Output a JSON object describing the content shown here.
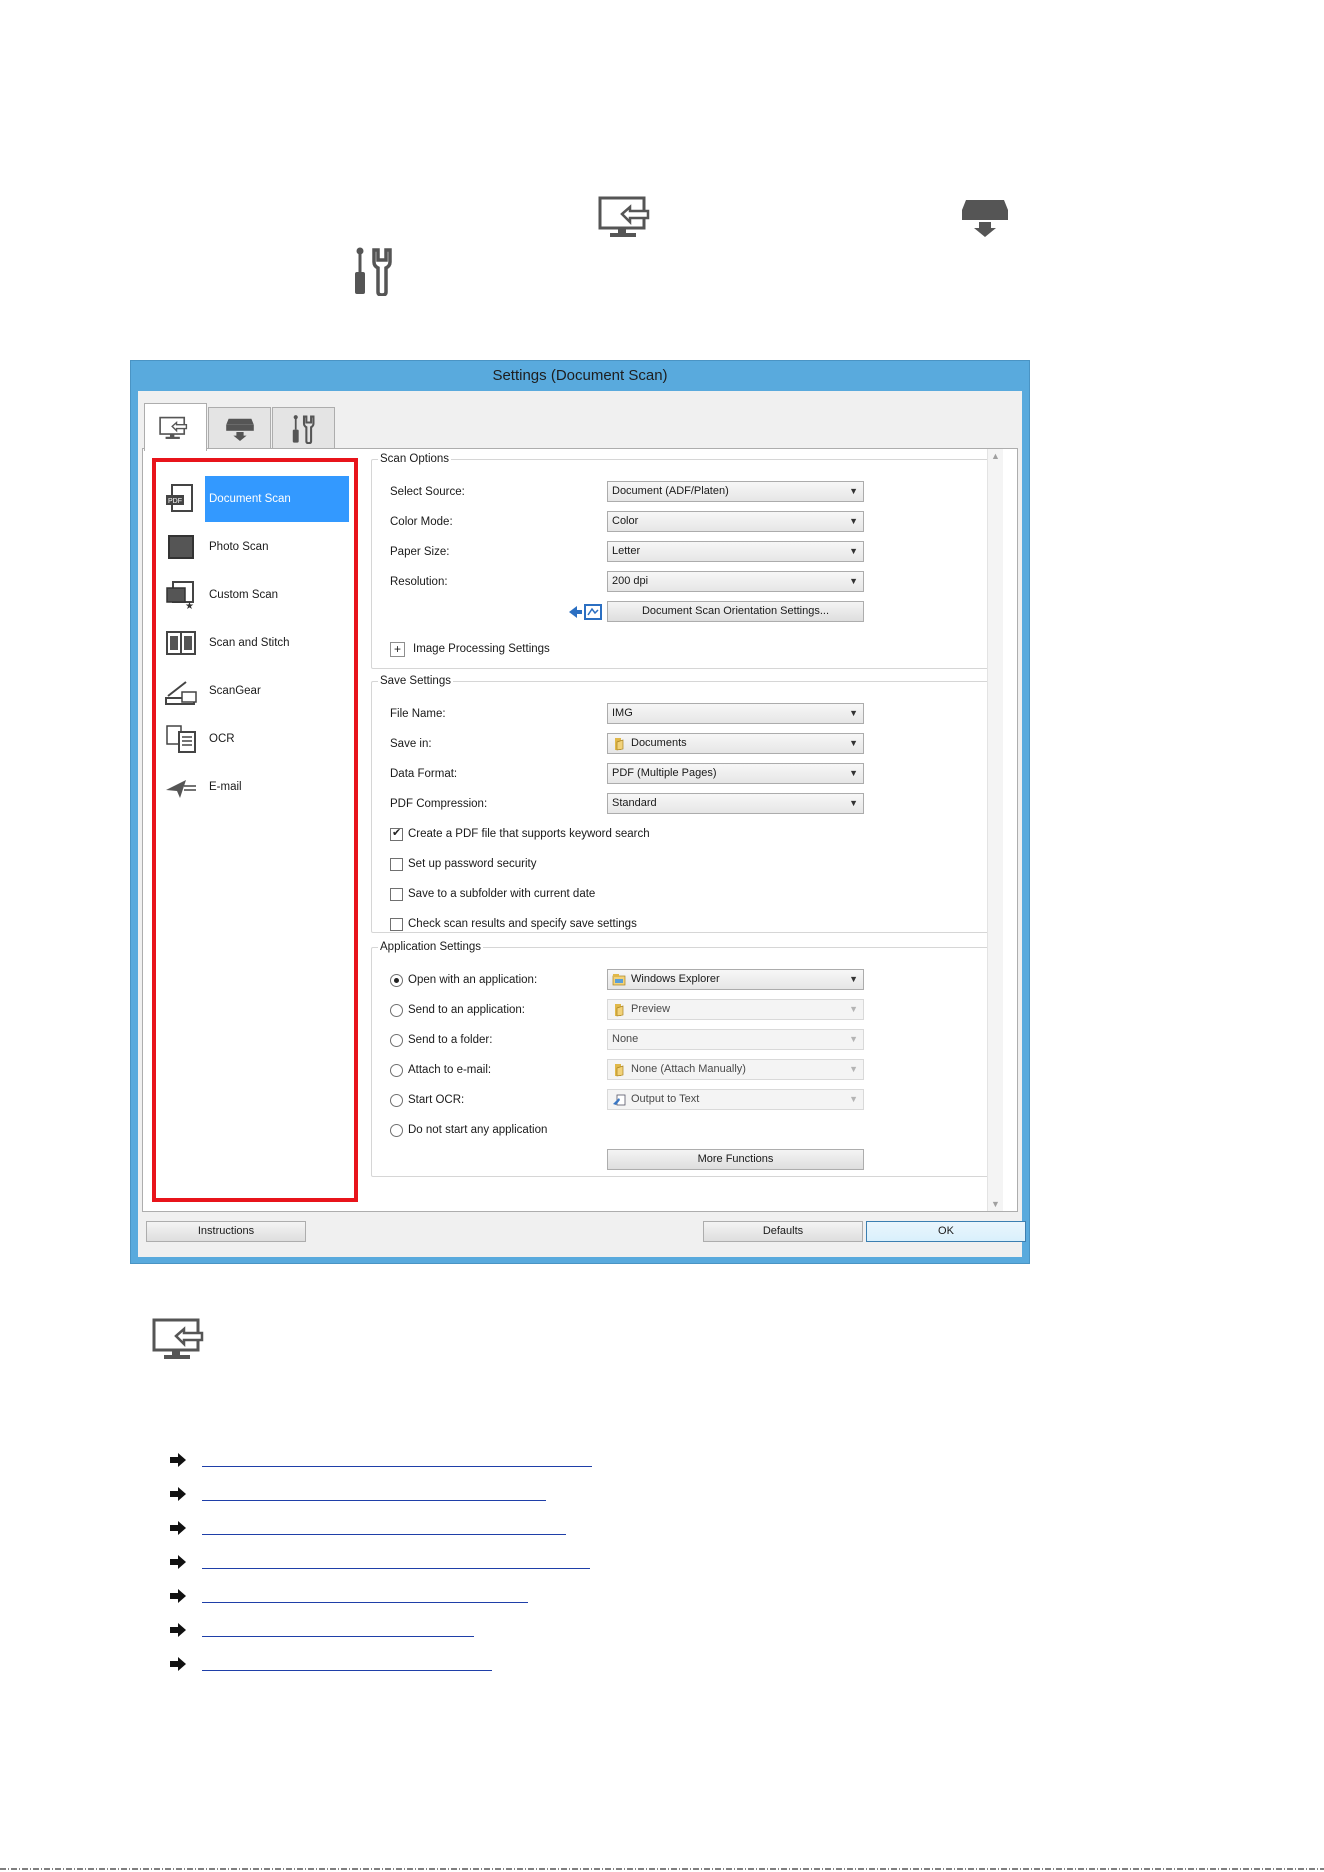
{
  "dialog": {
    "title": "Settings (Document Scan)"
  },
  "tabs": [
    {
      "name": "Scan from a Computer"
    },
    {
      "name": "Scan from Operation Panel"
    },
    {
      "name": "General Settings"
    }
  ],
  "modes": [
    {
      "label": "Document Scan",
      "icon": "pdf-document-icon",
      "selected": true
    },
    {
      "label": "Photo Scan",
      "icon": "photo-icon",
      "selected": false
    },
    {
      "label": "Custom Scan",
      "icon": "custom-scan-icon",
      "selected": false
    },
    {
      "label": "Scan and Stitch",
      "icon": "stitch-icon",
      "selected": false
    },
    {
      "label": "ScanGear",
      "icon": "scangear-icon",
      "selected": false
    },
    {
      "label": "OCR",
      "icon": "ocr-icon",
      "selected": false
    },
    {
      "label": "E-mail",
      "icon": "email-icon",
      "selected": false
    }
  ],
  "scan_options": {
    "legend": "Scan Options",
    "select_source_label": "Select Source:",
    "select_source_value": "Document (ADF/Platen)",
    "color_mode_label": "Color Mode:",
    "color_mode_value": "Color",
    "paper_size_label": "Paper Size:",
    "paper_size_value": "Letter",
    "resolution_label": "Resolution:",
    "resolution_value": "200 dpi",
    "orientation_button": "Document Scan Orientation Settings...",
    "image_processing_label": "Image Processing Settings",
    "expander_symbol": "+"
  },
  "save_settings": {
    "legend": "Save Settings",
    "file_name_label": "File Name:",
    "file_name_value": "IMG",
    "save_in_label": "Save in:",
    "save_in_value": "Documents",
    "data_format_label": "Data Format:",
    "data_format_value": "PDF (Multiple Pages)",
    "pdf_compression_label": "PDF Compression:",
    "pdf_compression_value": "Standard",
    "chk_keyword_search": "Create a PDF file that supports keyword search",
    "chk_password": "Set up password security",
    "chk_subfolder": "Save to a subfolder with current date",
    "chk_check_results": "Check scan results and specify save settings"
  },
  "application_settings": {
    "legend": "Application Settings",
    "open_with_label": "Open with an application:",
    "open_with_value": "Windows Explorer",
    "send_to_app_label": "Send to an application:",
    "send_to_app_value": "Preview",
    "send_to_folder_label": "Send to a folder:",
    "send_to_folder_value": "None",
    "attach_email_label": "Attach to e-mail:",
    "attach_email_value": "None (Attach Manually)",
    "start_ocr_label": "Start OCR:",
    "start_ocr_value": "Output to Text",
    "no_app_label": "Do not start any application",
    "more_functions_button": "More Functions"
  },
  "footer_buttons": {
    "instructions": "Instructions",
    "defaults": "Defaults",
    "ok": "OK"
  },
  "colors": {
    "highlight_border": "#e8141b",
    "selected_item": "#3399ff",
    "titlebar": "#59aadd",
    "link": "#1f3fa8"
  },
  "link_count": 7
}
